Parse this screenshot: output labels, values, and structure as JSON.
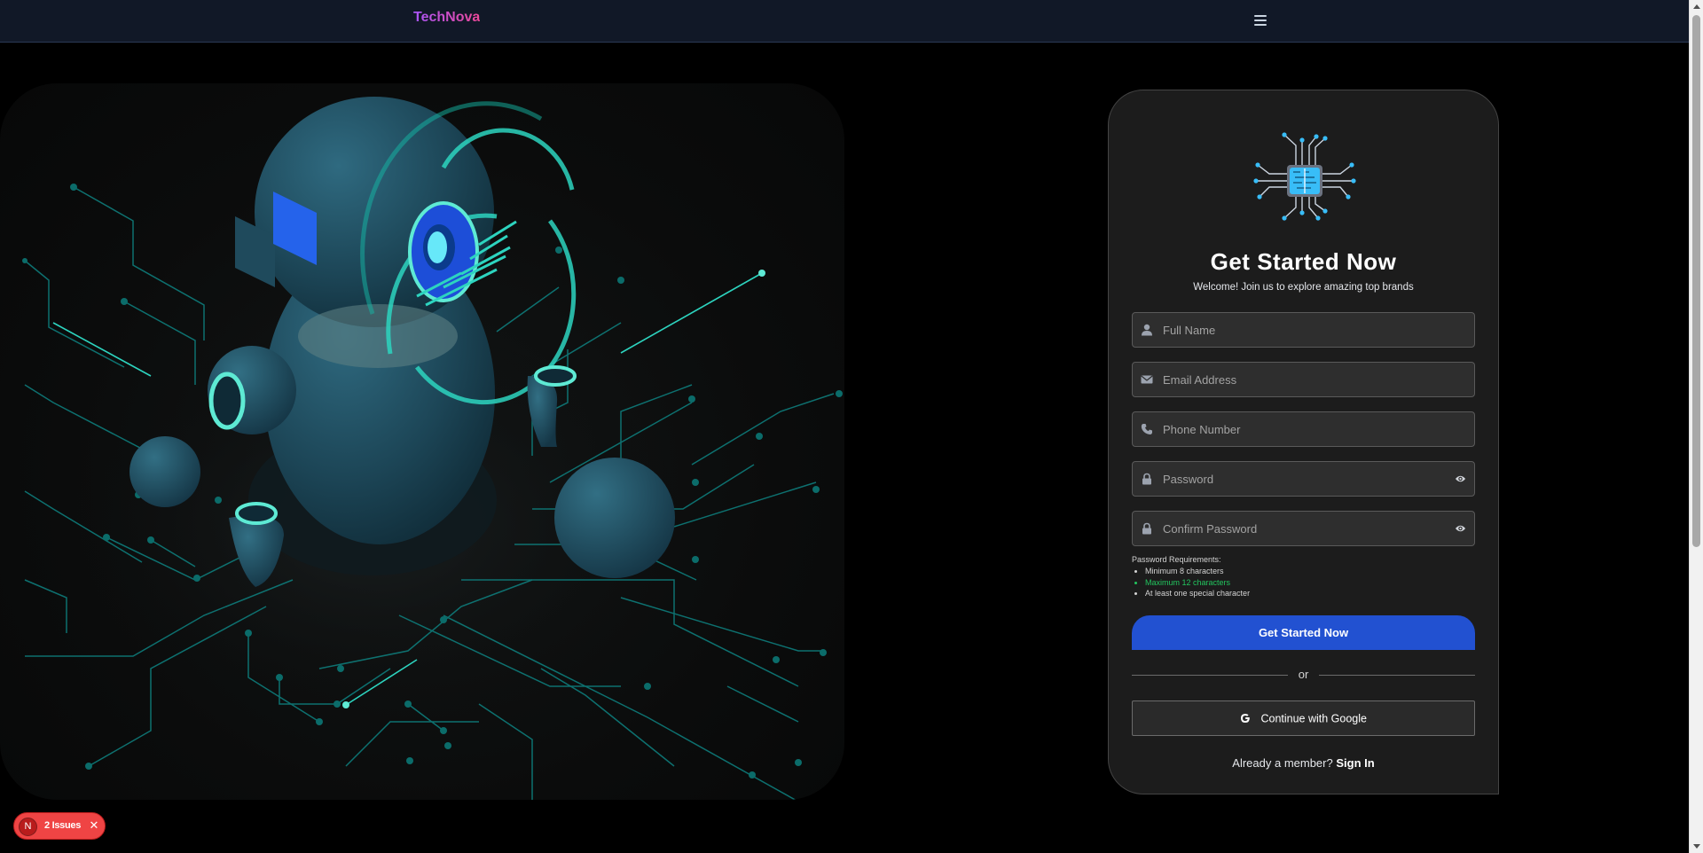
{
  "navbar": {
    "brand": "TechNova",
    "menu_icon": "hamburger-menu-icon"
  },
  "hero": {
    "image": "robot-circuit-illustration",
    "accent_color": "#2dd4bf"
  },
  "signup": {
    "logo_icon": "circuit-chip-icon",
    "title": "Get Started Now",
    "subtitle": "Welcome! Join us to explore amazing top brands",
    "fields": {
      "full_name": {
        "placeholder": "Full Name",
        "icon": "user-icon"
      },
      "email": {
        "placeholder": "Email Address",
        "icon": "envelope-icon"
      },
      "phone": {
        "placeholder": "Phone Number",
        "icon": "phone-icon"
      },
      "password": {
        "placeholder": "Password",
        "icon": "lock-icon",
        "toggle_icon": "eye-icon"
      },
      "confirm_password": {
        "placeholder": "Confirm Password",
        "icon": "lock-icon",
        "toggle_icon": "eye-icon"
      }
    },
    "requirements": {
      "heading": "Password Requirements:",
      "items": [
        {
          "text": "Minimum 8 characters",
          "met": false
        },
        {
          "text": "Maximum 12 characters",
          "met": true
        },
        {
          "text": "At least one special character",
          "met": false
        }
      ]
    },
    "submit_label": "Get Started Now",
    "divider_text": "or",
    "google_label": "Continue with Google",
    "member_text": "Already a member?",
    "sign_in_label": "Sign In",
    "colors": {
      "primary": "#2251d1",
      "success": "#22c55e",
      "card_bg": "#1c1c1c"
    }
  },
  "issues_badge": {
    "avatar_letter": "N",
    "label": "2 Issues",
    "close_icon": "close-icon",
    "color": "#ef4444"
  }
}
